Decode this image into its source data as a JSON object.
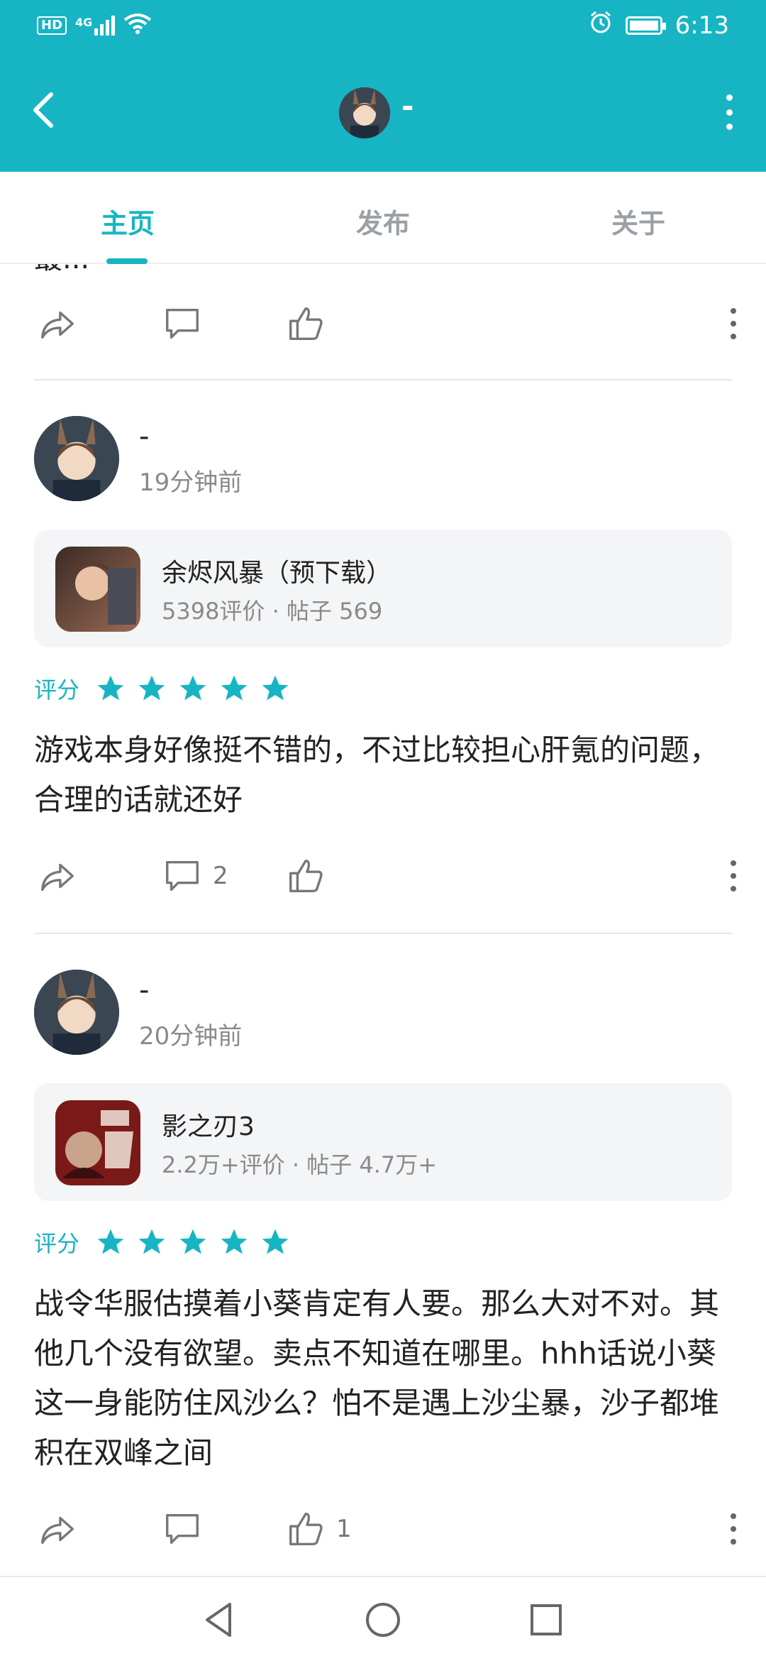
{
  "status_bar": {
    "left_icons": [
      "hd-icon",
      "signal-4g-icon",
      "wifi-icon"
    ],
    "hd_label": "HD",
    "network_label": "4G",
    "time": "6:13"
  },
  "header": {
    "title": "-",
    "back_icon": "back-arrow-icon",
    "more_icon": "more-vertical-icon",
    "bg_color": "#17b5c3"
  },
  "tabs": [
    {
      "label": "主页",
      "active": true
    },
    {
      "label": "发布",
      "active": false
    },
    {
      "label": "关于",
      "active": false
    }
  ],
  "feed": {
    "partial_text": "最...",
    "posts": [
      {
        "user": "-",
        "time": "19分钟前",
        "game": {
          "name": "余烬风暴（预下载）",
          "meta": "5398评价 · 帖子 569"
        },
        "rating_label": "评分",
        "stars": 5,
        "text": "游戏本身好像挺不错的，不过比较担心肝氪的问题，合理的话就还好",
        "comments": "2",
        "likes": ""
      },
      {
        "user": "-",
        "time": "20分钟前",
        "game": {
          "name": "影之刃3",
          "meta": "2.2万+评价 · 帖子 4.7万+"
        },
        "rating_label": "评分",
        "stars": 5,
        "text": "战令华服估摸着小葵肯定有人要。那么大对不对。其他几个没有欲望。卖点不知道在哪里。hhh话说小葵这一身能防住风沙么？怕不是遇上沙尘暴，沙子都堆积在双峰之间",
        "comments": "",
        "likes": "1"
      }
    ]
  },
  "bottom_nav": [
    "back-triangle-icon",
    "home-circle-icon",
    "recents-square-icon"
  ],
  "colors": {
    "accent": "#17b5c3",
    "star": "#17b5c3",
    "card_bg": "#f4f5f7"
  }
}
